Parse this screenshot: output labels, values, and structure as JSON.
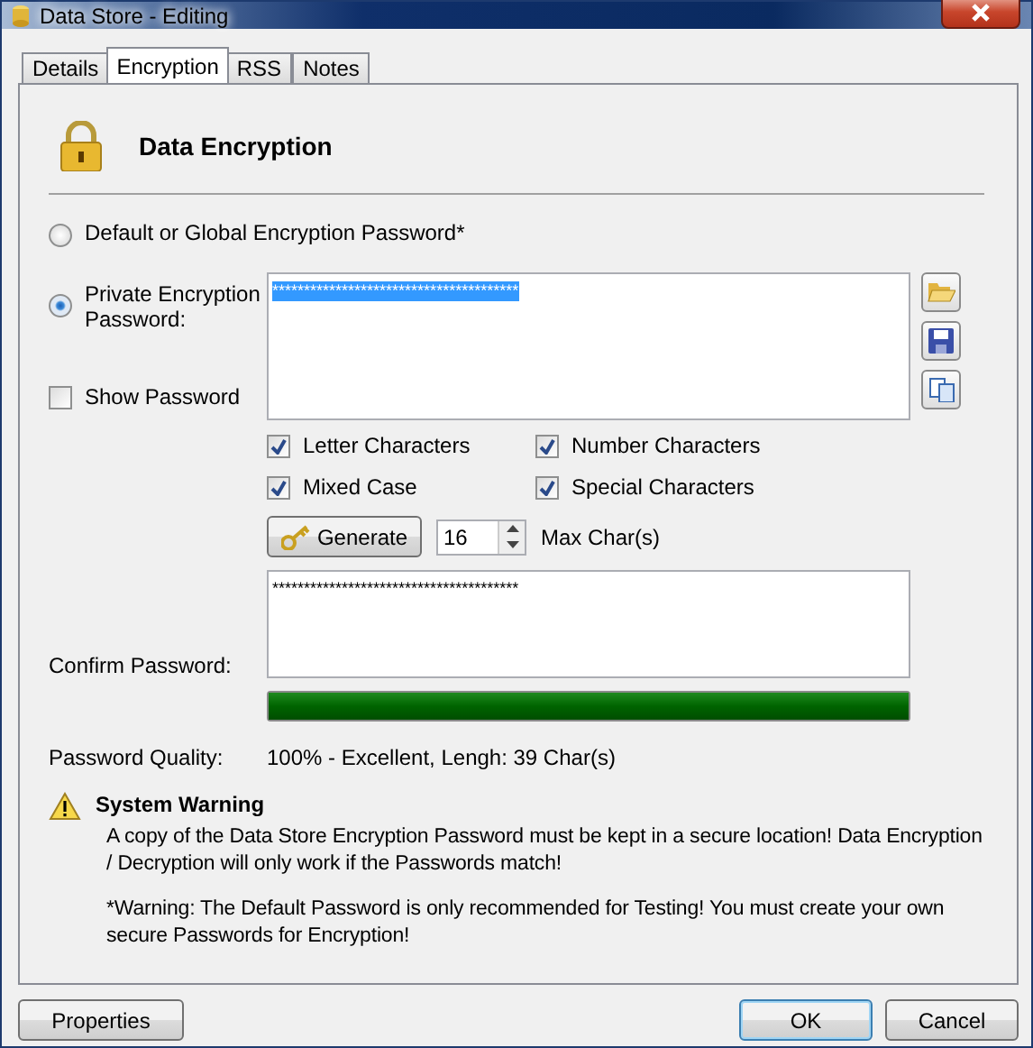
{
  "window": {
    "title": "Data Store - Editing"
  },
  "tabs": [
    {
      "label": "Details",
      "selected": false
    },
    {
      "label": "Encryption",
      "selected": true
    },
    {
      "label": "RSS",
      "selected": false
    },
    {
      "label": "Notes",
      "selected": false
    }
  ],
  "heading": "Data Encryption",
  "password_options": [
    {
      "label": "Default or Global Encryption Password*",
      "selected": false
    },
    {
      "label": "Private Encryption Password:",
      "selected": true
    }
  ],
  "password": {
    "value": "***************************************",
    "text_selected": true
  },
  "show_password": {
    "label": "Show Password",
    "checked": false
  },
  "char_options": [
    {
      "label": "Letter Characters",
      "checked": true
    },
    {
      "label": "Number Characters",
      "checked": true
    },
    {
      "label": "Mixed Case",
      "checked": true
    },
    {
      "label": "Special Characters",
      "checked": true
    }
  ],
  "generate": {
    "button": "Generate",
    "max_chars": "16",
    "max_label": "Max Char(s)"
  },
  "confirm": {
    "label": "Confirm Password:",
    "value": "***************************************"
  },
  "quality": {
    "level": 1,
    "label": "Password Quality:",
    "value": "100% - Excellent, Lengh: 39 Char(s)"
  },
  "warning": {
    "title": "System Warning",
    "paragraphs": [
      "A copy of the Data Store Encryption Password must be kept in a secure location! Data Encryption / Decryption will only work if the Passwords match!",
      "*Warning: The Default Password is only recommended for Testing! You must create your own secure Passwords for Encryption!"
    ]
  },
  "buttons": {
    "left": "Properties",
    "ok": "OK",
    "cancel": "Cancel"
  }
}
